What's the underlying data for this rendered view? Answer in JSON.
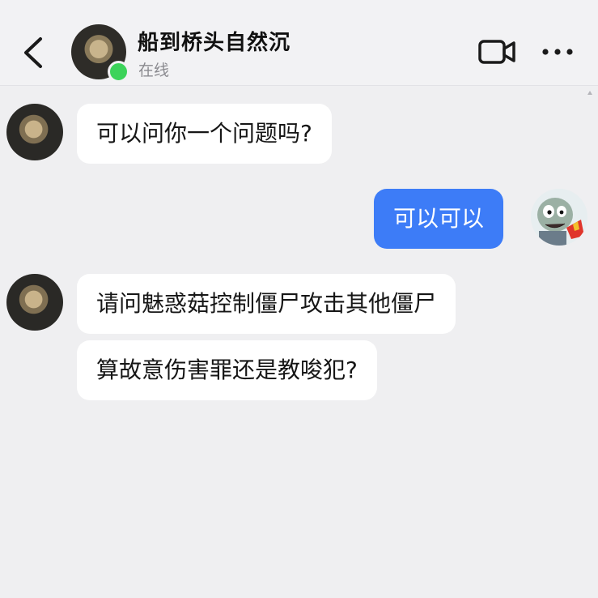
{
  "header": {
    "contact_name": "船到桥头自然沉",
    "status": "在线"
  },
  "icons": {
    "back": "chevron-left-icon",
    "video": "video-camera-icon",
    "more": "more-dots-icon"
  },
  "colors": {
    "outgoing_bubble": "#3d7cf7",
    "incoming_bubble": "#ffffff",
    "online": "#3cd35a",
    "background": "#efeff1"
  },
  "messages": [
    {
      "direction": "incoming",
      "text": "可以问你一个问题吗?"
    },
    {
      "direction": "outgoing",
      "text": "可以可以"
    },
    {
      "direction": "incoming",
      "text": "请问魅惑菇控制僵尸攻击其他僵尸"
    },
    {
      "direction": "incoming",
      "text": "算故意伤害罪还是教唆犯?"
    }
  ]
}
